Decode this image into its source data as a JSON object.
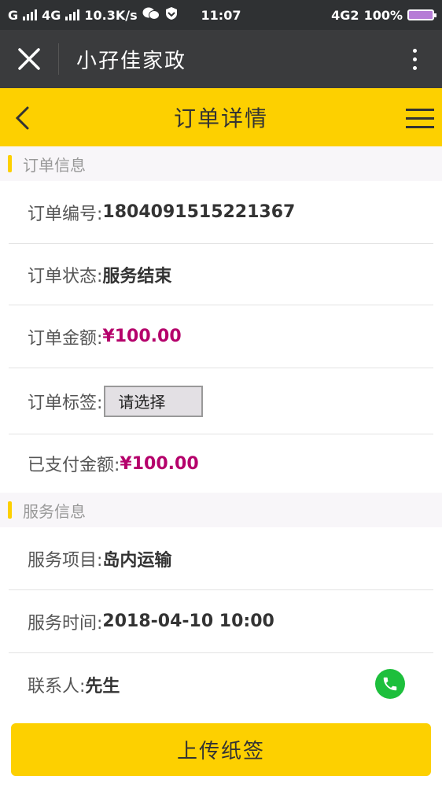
{
  "status_bar": {
    "carrier1": "G",
    "carrier2": "4G",
    "speed": "10.3K/s",
    "time": "11:07",
    "network": "4G2",
    "battery": "100%",
    "battery_color": "#b67dd6"
  },
  "app_bar": {
    "title": "小孖佳家政",
    "close_icon": "close-icon",
    "more_icon": "more-vertical-icon"
  },
  "header": {
    "title": "订单详情",
    "back_icon": "chevron-left-icon",
    "menu_icon": "hamburger-icon"
  },
  "order_section": {
    "title": "订单信息",
    "number_label": "订单编号:",
    "number_value": "1804091515221367",
    "status_label": "订单状态:",
    "status_value": "服务结束",
    "amount_label": "订单金额:",
    "amount_value": "¥100.00",
    "tag_label": "订单标签:",
    "tag_select": "请选择",
    "paid_label": "已支付金额:",
    "paid_value": "¥100.00"
  },
  "service_section": {
    "title": "服务信息",
    "item_label": "服务项目:",
    "item_value": "岛内运输",
    "time_label": "服务时间:",
    "time_value": "2018-04-10 10:00",
    "contact_label": "联系人:",
    "contact_value": "先生"
  },
  "footer": {
    "upload_label": "上传纸签"
  },
  "colors": {
    "accent": "#fdd000",
    "money": "#b5006b",
    "phone": "#1dbf3c",
    "dark_bar": "#3a3b3d"
  }
}
